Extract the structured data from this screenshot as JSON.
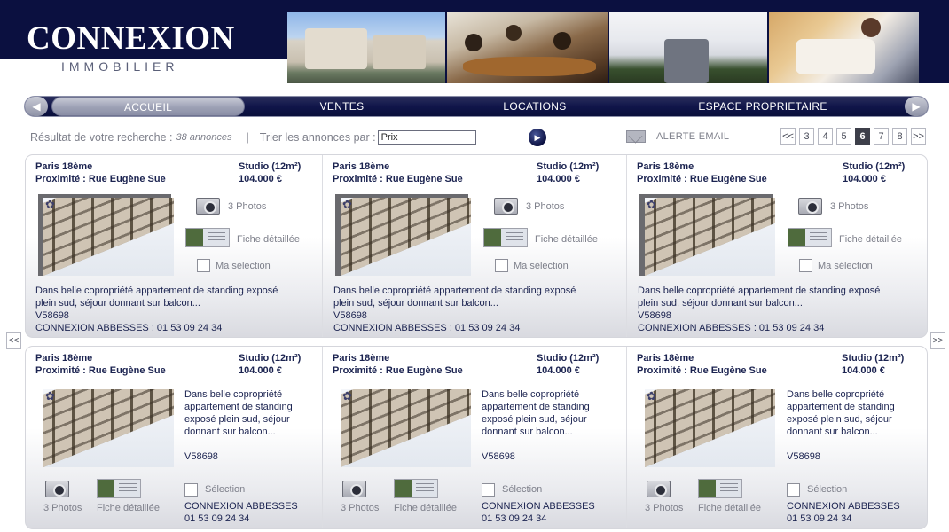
{
  "logo": {
    "name": "CONNEXION",
    "sub": "IMMOBILIER"
  },
  "nav": {
    "items": [
      "ACCUEIL",
      "VENTES",
      "LOCATIONS",
      "ESPACE PROPRIETAIRE"
    ],
    "active": "ACCUEIL"
  },
  "search": {
    "result_label": "Résultat de votre recherche :",
    "result_count": "38 annonces",
    "separator": "|",
    "sort_label": "Trier les annonces par :",
    "sort_value": "Prix"
  },
  "alert": {
    "label": "ALERTE EMAIL"
  },
  "pager": {
    "first": "<<",
    "pages": [
      "3",
      "4",
      "5",
      "6",
      "7",
      "8"
    ],
    "current": "6",
    "last": ">>"
  },
  "side_nav": {
    "prev": "<<",
    "next": ">>"
  },
  "listings": [
    {
      "city": "Paris 18ème",
      "proximity": "Proximité : Rue Eugène Sue",
      "type": "Studio (12m²)",
      "price": "104.000 €",
      "photos_label": "3 Photos",
      "fiche_label": "Fiche détaillée",
      "selection_label": "Ma sélection",
      "description": "Dans belle copropriété appartement de standing exposé plein sud, séjour donnant sur balcon...",
      "ref": "V58698",
      "agency": "CONNEXION ABBESSES : 01 53 09 24 34"
    },
    {
      "city": "Paris 18ème",
      "proximity": "Proximité : Rue Eugène Sue",
      "type": "Studio (12m²)",
      "price": "104.000 €",
      "photos_label": "3 Photos",
      "fiche_label": "Fiche détaillée",
      "selection_label": "Ma sélection",
      "description": "Dans belle copropriété appartement de standing exposé plein sud, séjour donnant sur balcon...",
      "ref": "V58698",
      "agency": "CONNEXION ABBESSES : 01 53 09 24 34"
    },
    {
      "city": "Paris 18ème",
      "proximity": "Proximité : Rue Eugène Sue",
      "type": "Studio (12m²)",
      "price": "104.000 €",
      "photos_label": "3 Photos",
      "fiche_label": "Fiche détaillée",
      "selection_label": "Ma sélection",
      "description": "Dans belle copropriété appartement de standing exposé plein sud, séjour donnant sur balcon...",
      "ref": "V58698",
      "agency": "CONNEXION ABBESSES : 01 53 09 24 34"
    },
    {
      "city": "Paris 18ème",
      "proximity": "Proximité : Rue Eugène Sue",
      "type": "Studio (12m²)",
      "price": "104.000 €",
      "photos_label": "3 Photos",
      "fiche_label": "Fiche détaillée",
      "selection_label": "Sélection",
      "description": "Dans belle copropriété appartement de standing exposé plein sud, séjour donnant sur balcon...",
      "ref": "V58698",
      "agency_name": "CONNEXION ABBESSES",
      "agency_phone": "01 53 09 24 34"
    },
    {
      "city": "Paris 18ème",
      "proximity": "Proximité : Rue Eugène Sue",
      "type": "Studio (12m²)",
      "price": "104.000 €",
      "photos_label": "3 Photos",
      "fiche_label": "Fiche détaillée",
      "selection_label": "Sélection",
      "description": "Dans belle copropriété appartement de standing exposé plein sud, séjour donnant sur balcon...",
      "ref": "V58698",
      "agency_name": "CONNEXION ABBESSES",
      "agency_phone": "01 53 09 24 34"
    },
    {
      "city": "Paris 18ème",
      "proximity": "Proximité : Rue Eugène Sue",
      "type": "Studio (12m²)",
      "price": "104.000 €",
      "photos_label": "3 Photos",
      "fiche_label": "Fiche détaillée",
      "selection_label": "Sélection",
      "description": "Dans belle copropriété appartement de standing exposé plein sud, séjour donnant sur balcon...",
      "ref": "V58698",
      "agency_name": "CONNEXION ABBESSES",
      "agency_phone": "01 53 09 24 34"
    }
  ],
  "icons": {
    "nav_prev": "chevron-left-icon",
    "nav_next": "chevron-right-icon",
    "go": "arrow-right-icon",
    "alert": "envelope-icon",
    "photos": "camera-icon",
    "fiche": "document-preview-icon",
    "selection": "checkbox-icon"
  },
  "colors": {
    "brand_navy": "#0b1040",
    "text_navy": "#1b2350",
    "muted_grey": "#7d7f8a"
  }
}
